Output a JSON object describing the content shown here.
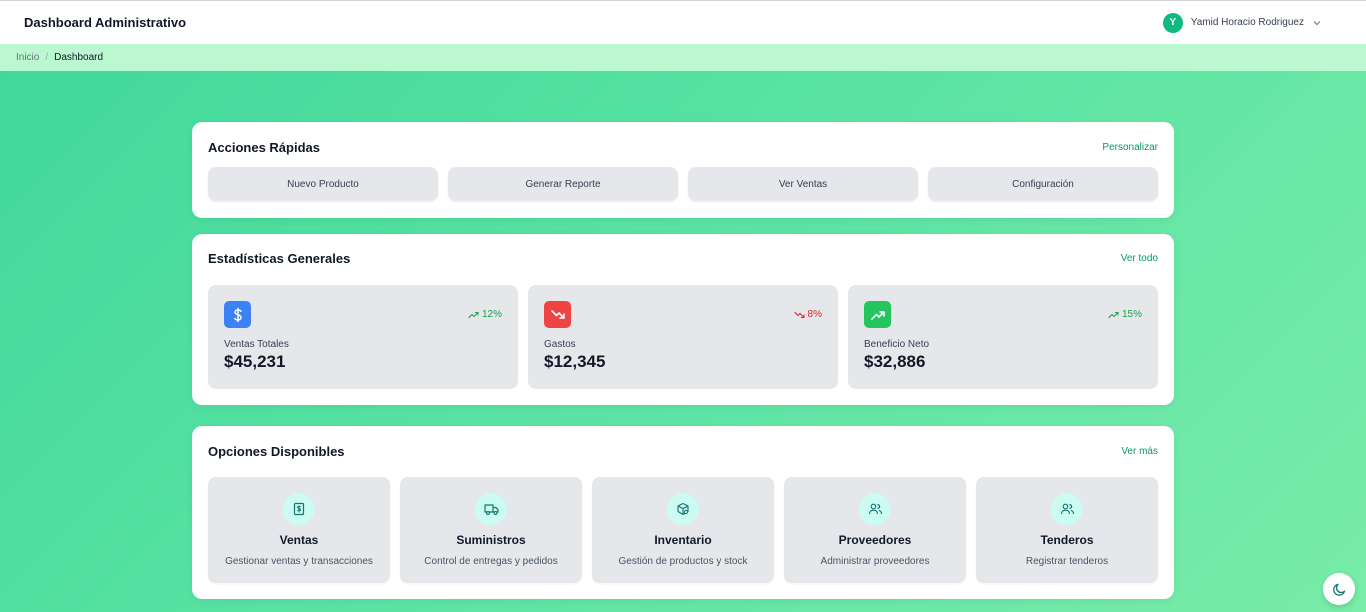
{
  "header": {
    "title": "Dashboard Administrativo",
    "user": {
      "initial": "Y",
      "name": "Yamid Horacio Rodriguez"
    }
  },
  "breadcrumb": {
    "home": "Inicio",
    "separator": "/",
    "current": "Dashboard"
  },
  "quick_actions": {
    "title": "Acciones Rápidas",
    "link": "Personalizar",
    "buttons": [
      "Nuevo Producto",
      "Generar Reporte",
      "Ver Ventas",
      "Configuración"
    ]
  },
  "stats": {
    "title": "Estadísticas Generales",
    "link": "Ver todo",
    "items": [
      {
        "label": "Ventas Totales",
        "value": "$45,231",
        "trend": "12%",
        "direction": "up",
        "icon": "dollar-icon",
        "color": "#3b82f6"
      },
      {
        "label": "Gastos",
        "value": "$12,345",
        "trend": "8%",
        "direction": "down",
        "icon": "trending-down-icon",
        "color": "#ef4444"
      },
      {
        "label": "Beneficio Neto",
        "value": "$32,886",
        "trend": "15%",
        "direction": "up",
        "icon": "trending-up-icon",
        "color": "#22c55e"
      }
    ]
  },
  "options": {
    "title": "Opciones Disponibles",
    "link": "Ver más",
    "items": [
      {
        "title": "Ventas",
        "desc": "Gestionar ventas y transacciones",
        "icon": "receipt-icon"
      },
      {
        "title": "Suministros",
        "desc": "Control de entregas y pedidos",
        "icon": "truck-icon"
      },
      {
        "title": "Inventario",
        "desc": "Gestión de productos y stock",
        "icon": "package-search-icon"
      },
      {
        "title": "Proveedores",
        "desc": "Administrar proveedores",
        "icon": "users-icon"
      },
      {
        "title": "Tenderos",
        "desc": "Registrar tenderos",
        "icon": "users-icon"
      }
    ]
  },
  "colors": {
    "accent": "#059669",
    "icon_bg": "#ccfbf1",
    "icon_fg": "#0f766e"
  },
  "theme_toggle": {
    "icon": "moon-icon"
  }
}
